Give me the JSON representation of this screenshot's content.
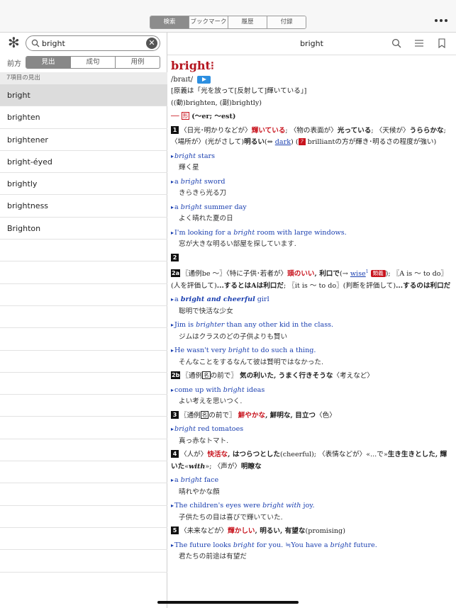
{
  "top_tabs": [
    "検索",
    "ブックマーク",
    "履歴",
    "付録"
  ],
  "top_active": 0,
  "search": {
    "value": "bright"
  },
  "mode": {
    "label": "前方",
    "tabs": [
      "見出",
      "成句",
      "用例"
    ],
    "active": 0
  },
  "results": {
    "count_label": "7項目の見出",
    "items": [
      "bright",
      "brighten",
      "brightener",
      "bright-éyed",
      "brightly",
      "brightness",
      "Brighton"
    ]
  },
  "detail": {
    "title": "bright",
    "headword": "bright",
    "headword_marks": "⁝",
    "pron": "/braɪt/",
    "origin": "[原義は「光を放って[反射して]輝いている」]",
    "derived": "((動)brighten, (副)brightly)",
    "pos_line": {
      "dash": "──",
      "pos": "形",
      "forms": "(～er; ～est)"
    },
    "s1": {
      "num": "1",
      "t1": "〈日光･明かりなどが〉",
      "t2": "輝いている",
      "t3": "; 〈物の表面が〉",
      "t4": "光っている",
      "t5": "; 〈天候が〉",
      "t6": "うららかな",
      "t7": "; 〈場所が〉(光がさして)",
      "t8": "明るい",
      "t9": "(⇔ ",
      "link": "dark",
      "t10": ") (",
      "note": "?",
      "t11": " brilliantの方が輝き･明るさの程度が強い)"
    },
    "ex1": [
      {
        "pre": "",
        "em": "bright",
        "post": " stars",
        "ja": "輝く星"
      },
      {
        "pre": "a ",
        "em": "bright",
        "post": " sword",
        "ja": "きらきら光る刀"
      },
      {
        "pre": "a ",
        "em": "bright",
        "post": " summer day",
        "ja": "よく晴れた夏の日"
      },
      {
        "pre": "I'm looking for a ",
        "em": "bright",
        "post": " room with large windows.",
        "ja": "窓が大きな明るい部屋を探しています."
      }
    ],
    "s2": {
      "num": "2"
    },
    "s2a": {
      "num": "2a",
      "t1": "〖通例be ～〗〈特に子供･若者が〉",
      "t2": "頭のいい",
      "t3": ", 利口で",
      "t4": "(→ ",
      "link": "wise",
      "sup": "1",
      "tag": "類義",
      "t5": "); 〖A is ～ to do〗(人を評価して)",
      "t6": "...するとはAは利口だ",
      "t7": "; 〖it is ～ to do〗(判断を評価して)",
      "t8": "...するのは利口だ"
    },
    "ex2a": [
      {
        "pre": "a ",
        "em": "bright and cheerful",
        "post": " girl",
        "ja": "聡明で快活な少女",
        "bold": true
      },
      {
        "pre": "Jim is ",
        "em": "brighter",
        "post": " than any other kid in the class.",
        "ja": "ジムはクラスのどの子供よりも賢い"
      },
      {
        "pre": "He wasn't very ",
        "em": "bright",
        "post": " to do such a thing.",
        "ja": "そんなことをするなんて彼は賢明ではなかった."
      }
    ],
    "s2b": {
      "num": "2b",
      "t1": "〖通例",
      "box": "名",
      "t2": "の前で〗",
      "t3": "気の利いた, うまく行きそうな",
      "t4": "〈考えなど〉"
    },
    "ex2b": [
      {
        "pre": "come up with ",
        "em": "bright",
        "post": " ideas",
        "ja": "よい考えを思いつく."
      }
    ],
    "s3": {
      "num": "3",
      "t1": "〖通例",
      "box": "名",
      "t2": "の前で〗",
      "t3": "鮮やかな",
      "t4": ", 鮮明な, 目立つ",
      "t5": "〈色〉"
    },
    "ex3": [
      {
        "pre": "",
        "em": "bright",
        "post": " red tomatoes",
        "ja": "真っ赤なトマト."
      }
    ],
    "s4": {
      "num": "4",
      "t1": "〈人が〉",
      "t2": "快活な",
      "t3": ", はつらつとした",
      "t4": "(cheerful); 〈表情などが〉«...で»",
      "t5": "生き生きとした, 輝いた",
      "t6": "«",
      "t7": "with",
      "t8": "»; 〈声が〉",
      "t9": "明瞭な"
    },
    "ex4": [
      {
        "pre": "a ",
        "em": "bright",
        "post": " face",
        "ja": "晴れやかな顔"
      },
      {
        "pre": "The children's eyes were ",
        "em": "bright with",
        "post": " joy.",
        "ja": "子供たちの目は喜びで輝いていた."
      }
    ],
    "s5": {
      "num": "5",
      "t1": "〈未来などが〉",
      "t2": "輝かしい",
      "t3": ", 明るい, 有望な",
      "t4": "(promising)"
    },
    "ex5": [
      {
        "pre": "The future looks ",
        "em": "bright",
        "post": " for you. ≒You have a ",
        "em2": "bright",
        "post2": " future.",
        "ja": "君たちの前途は有望だ"
      }
    ]
  }
}
